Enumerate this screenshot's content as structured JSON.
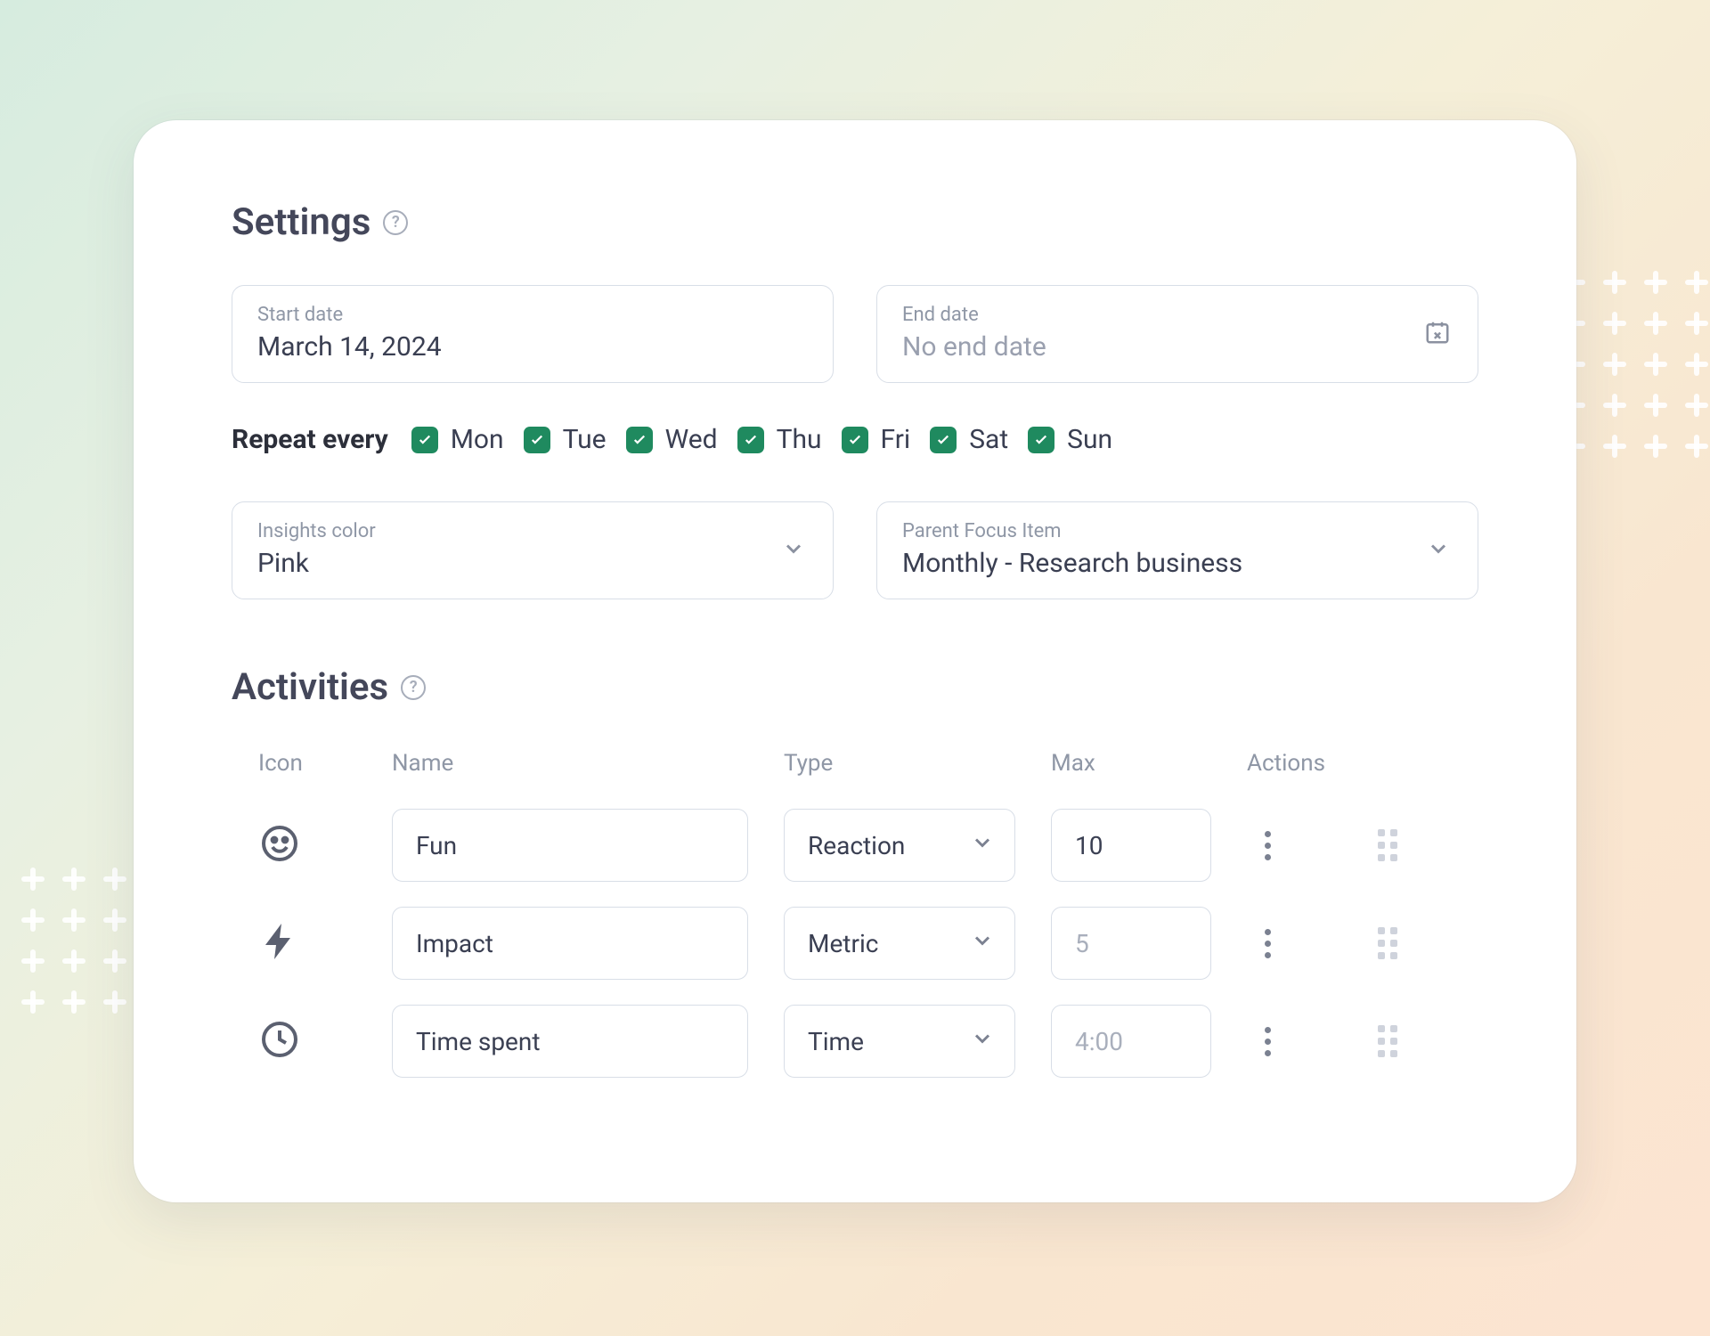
{
  "settings": {
    "heading": "Settings",
    "start_date": {
      "label": "Start date",
      "value": "March 14, 2024"
    },
    "end_date": {
      "label": "End date",
      "placeholder": "No end date"
    },
    "repeat_label": "Repeat every",
    "days": [
      {
        "key": "mon",
        "label": "Mon",
        "checked": true
      },
      {
        "key": "tue",
        "label": "Tue",
        "checked": true
      },
      {
        "key": "wed",
        "label": "Wed",
        "checked": true
      },
      {
        "key": "thu",
        "label": "Thu",
        "checked": true
      },
      {
        "key": "fri",
        "label": "Fri",
        "checked": true
      },
      {
        "key": "sat",
        "label": "Sat",
        "checked": true
      },
      {
        "key": "sun",
        "label": "Sun",
        "checked": true
      }
    ],
    "insights_color": {
      "label": "Insights color",
      "value": "Pink"
    },
    "parent_focus": {
      "label": "Parent Focus Item",
      "value": "Monthly - Research business"
    }
  },
  "activities": {
    "heading": "Activities",
    "columns": {
      "icon": "Icon",
      "name": "Name",
      "type": "Type",
      "max": "Max",
      "actions": "Actions"
    },
    "rows": [
      {
        "icon": "smile-icon",
        "name": "Fun",
        "type": "Reaction",
        "max": "10",
        "max_placeholder": false
      },
      {
        "icon": "bolt-icon",
        "name": "Impact",
        "type": "Metric",
        "max": "5",
        "max_placeholder": true
      },
      {
        "icon": "clock-icon",
        "name": "Time spent",
        "type": "Time",
        "max": "4:00",
        "max_placeholder": true
      }
    ]
  }
}
